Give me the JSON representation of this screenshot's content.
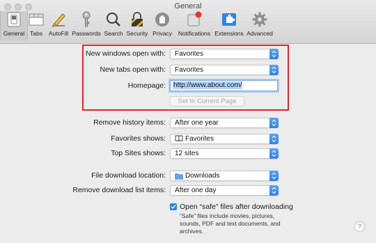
{
  "window": {
    "title": "General"
  },
  "toolbar": {
    "items": [
      {
        "label": "General",
        "icon": "general-switch-icon",
        "selected": true
      },
      {
        "label": "Tabs",
        "icon": "tabs-icon"
      },
      {
        "label": "AutoFill",
        "icon": "pencil-icon"
      },
      {
        "label": "Passwords",
        "icon": "key-icon"
      },
      {
        "label": "Search",
        "icon": "magnifier-icon"
      },
      {
        "label": "Security",
        "icon": "lock-icon"
      },
      {
        "label": "Privacy",
        "icon": "hand-icon"
      },
      {
        "label": "Notifications",
        "icon": "notification-icon"
      },
      {
        "label": "Extensions",
        "icon": "puzzle-icon"
      },
      {
        "label": "Advanced",
        "icon": "gear-icon"
      }
    ]
  },
  "settings": {
    "new_windows_label": "New windows open with:",
    "new_windows_value": "Favorites",
    "new_tabs_label": "New tabs open with:",
    "new_tabs_value": "Favorites",
    "homepage_label": "Homepage:",
    "homepage_value": "http://www.about.com/",
    "set_current_page": "Set to Current Page",
    "remove_history_label": "Remove history items:",
    "remove_history_value": "After one year",
    "favorites_shows_label": "Favorites shows:",
    "favorites_shows_value": "Favorites",
    "top_sites_label": "Top Sites shows:",
    "top_sites_value": "12 sites",
    "download_location_label": "File download location:",
    "download_location_value": "Downloads",
    "remove_downloads_label": "Remove download list items:",
    "remove_downloads_value": "After one day",
    "open_safe_label": "Open “safe” files after downloading",
    "open_safe_note": "“Safe” files include movies, pictures, sounds, PDF and text documents, and archives.",
    "help": "?"
  },
  "colors": {
    "highlight_box": "#e32624",
    "accent": "#2f7ff3"
  }
}
